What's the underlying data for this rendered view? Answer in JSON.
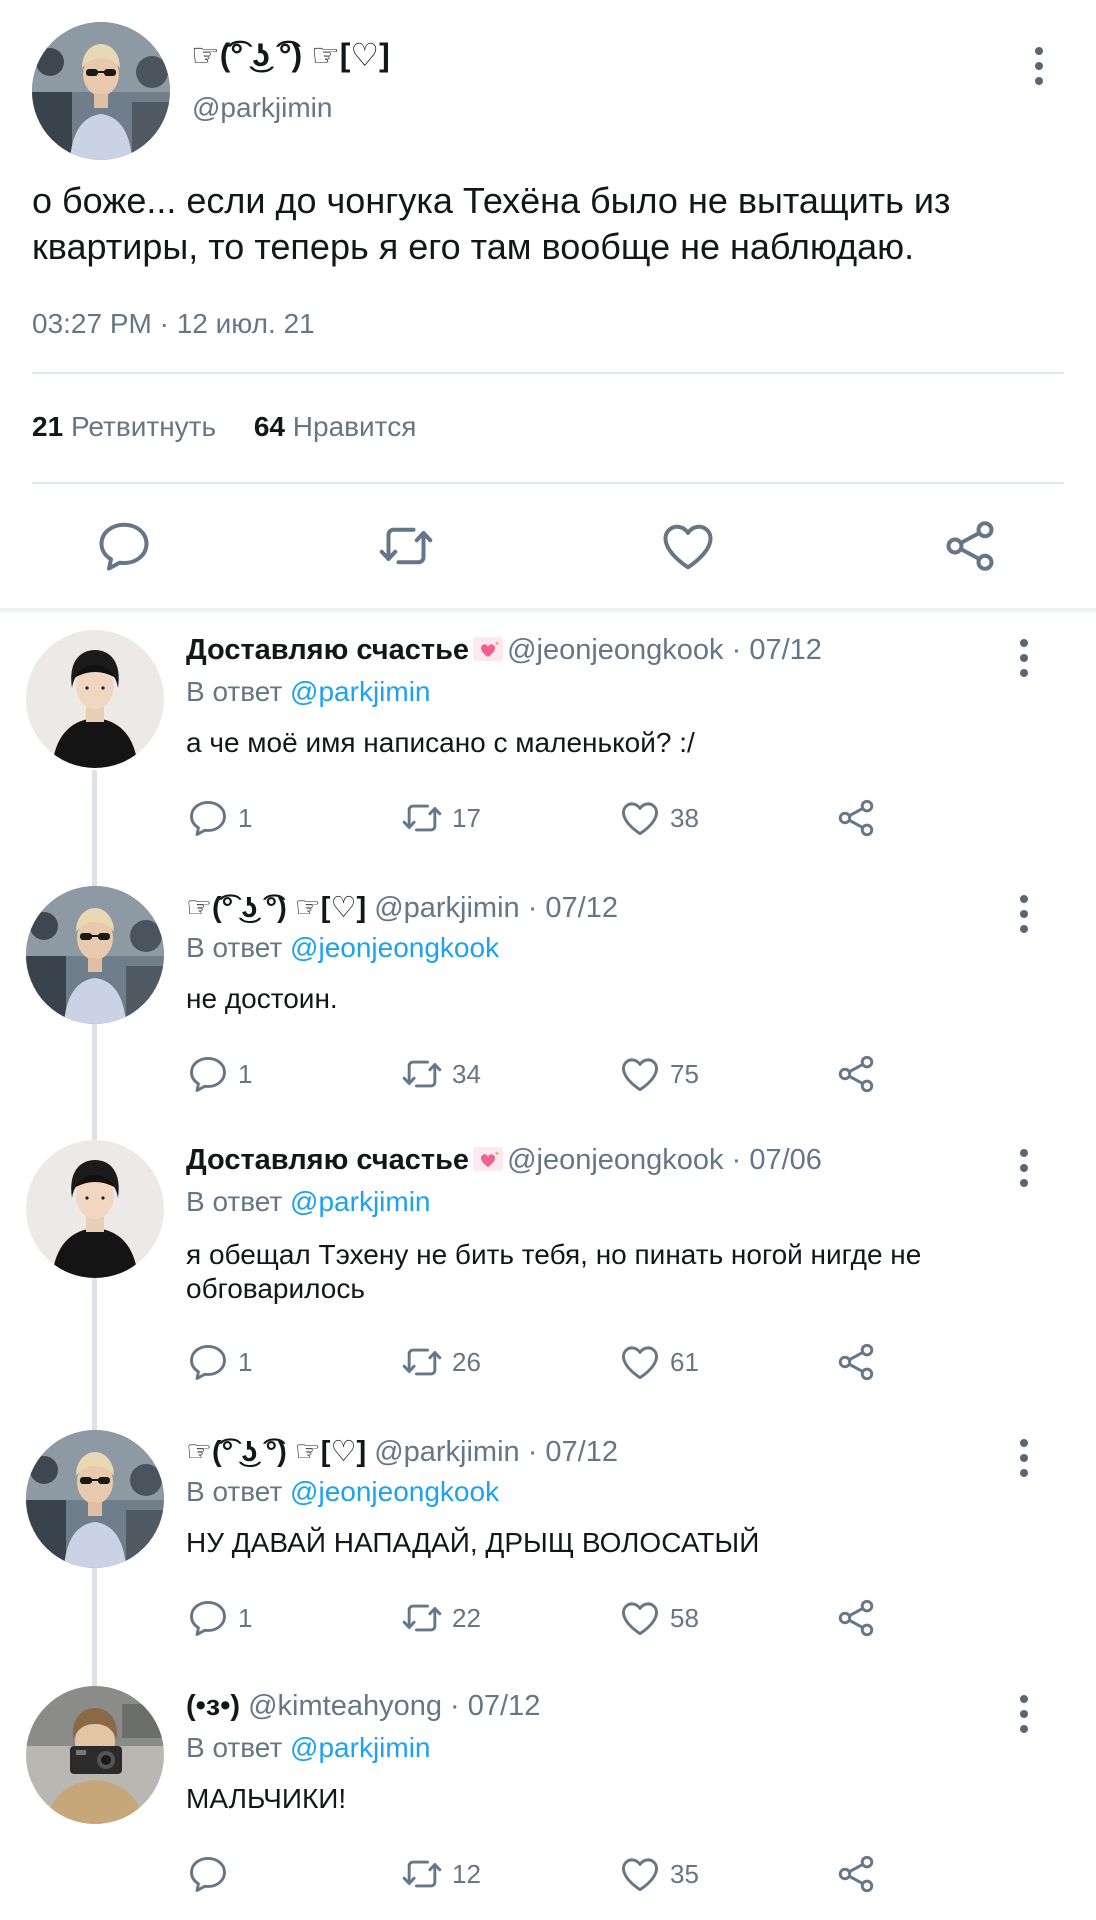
{
  "main_tweet": {
    "display_name": "☞(͡° ͜ʖ ͡°) ☞[♡]",
    "handle": "@parkjimin",
    "text": "о боже... если до чонгука Техёна было не вытащить из квартиры, то теперь я его там вообще не наблюдаю.",
    "timestamp": "03:27 PM · 12 июл. 21",
    "retweet_count": "21",
    "retweet_label": "Ретвитнуть",
    "like_count": "64",
    "like_label": "Нравится"
  },
  "in_reply_label": "В ответ",
  "replies": [
    {
      "display_name": "Доставляю счастье",
      "meta": "@jeonjeongkook · 07/12",
      "reply_to": "@parkjimin",
      "text": "а че моё имя написано с маленькой? :/",
      "replies": "1",
      "retweets": "17",
      "likes": "38"
    },
    {
      "display_name": "☞(͡° ͜ʖ ͡°) ☞[♡]",
      "meta": "@parkjimin · 07/12",
      "reply_to": "@jeonjeongkook",
      "text": "не достоин.",
      "replies": "1",
      "retweets": "34",
      "likes": "75"
    },
    {
      "display_name": "Доставляю счастье",
      "meta": "@jeonjeongkook · 07/06",
      "reply_to": "@parkjimin",
      "text": "я обещал Тэхену не бить тебя, но пинать ногой нигде не обговарилось",
      "replies": "1",
      "retweets": "26",
      "likes": "61"
    },
    {
      "display_name": "☞(͡° ͜ʖ ͡°) ☞[♡]",
      "meta": "@parkjimin · 07/12",
      "reply_to": "@jeonjeongkook",
      "text": "НУ ДАВАЙ НАПАДАЙ, ДРЫЩ ВОЛОСАТЫЙ",
      "replies": "1",
      "retweets": "22",
      "likes": "58"
    },
    {
      "display_name": "(•з•)",
      "meta": "@kimteahyong · 07/12",
      "reply_to": "@parkjimin",
      "text": "МАЛЬЧИКИ!",
      "replies": "",
      "retweets": "12",
      "likes": "35"
    }
  ],
  "colors": {
    "link": "#1da1f2",
    "muted": "#657786",
    "text": "#14171a",
    "divider": "#e1e8ed"
  },
  "icons": [
    "more-vertical-icon",
    "reply-icon",
    "retweet-icon",
    "like-icon",
    "share-icon",
    "sparkling-heart-emoji"
  ]
}
